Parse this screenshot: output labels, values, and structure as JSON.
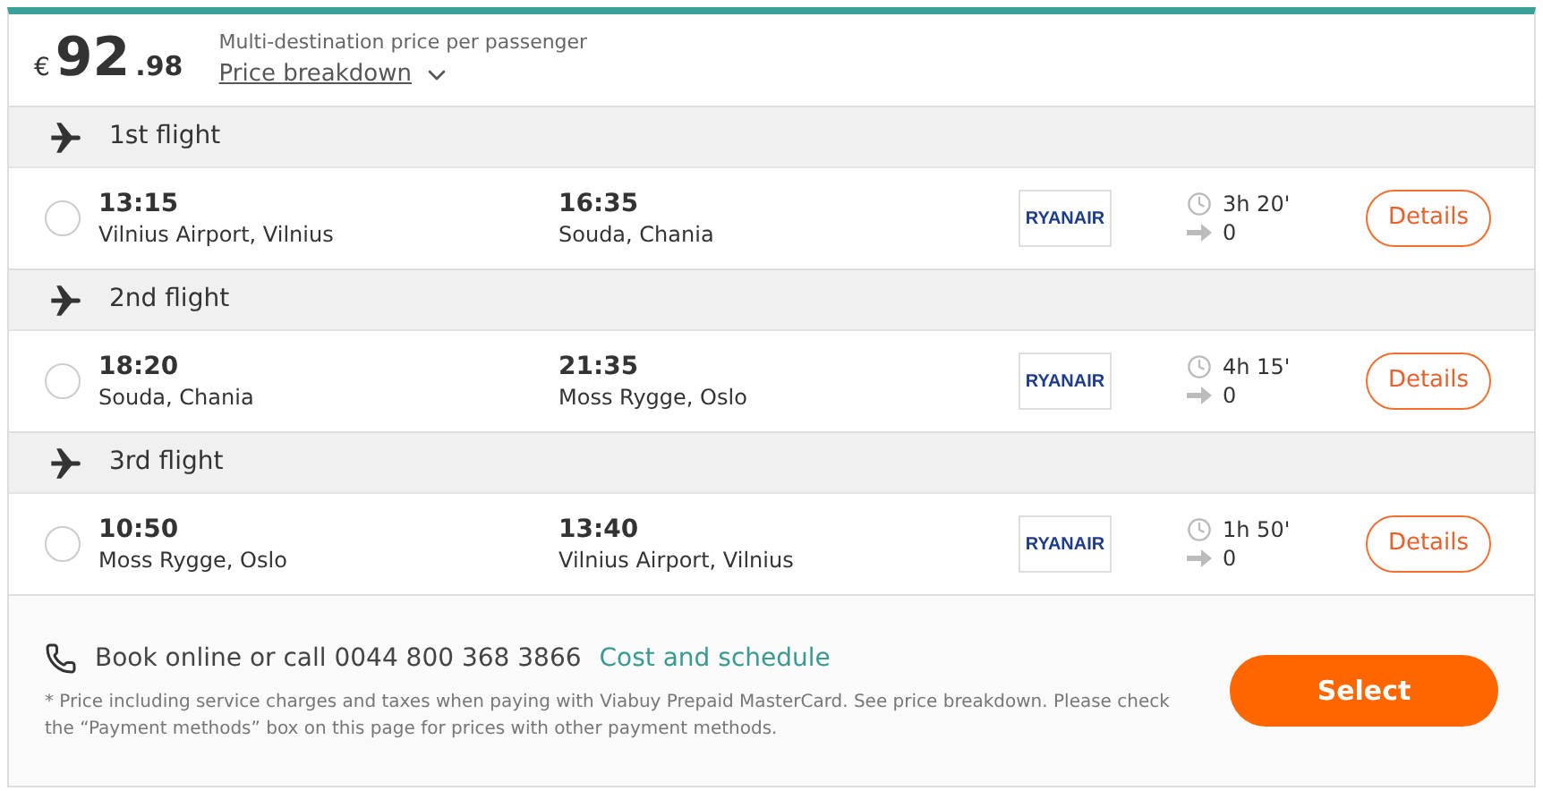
{
  "price": {
    "currency": "€",
    "whole": "92",
    "cents": ".98",
    "caption": "Multi-destination price per passenger",
    "breakdown_link": "Price breakdown"
  },
  "flights": [
    {
      "title": "1st flight",
      "selected": false,
      "depart_time": "13:15",
      "depart_place": "Vilnius Airport, Vilnius",
      "arrive_time": "16:35",
      "arrive_place": "Souda, Chania",
      "airline": "RYANAIR",
      "duration": "3h 20'",
      "stops": "0",
      "details": "Details"
    },
    {
      "title": "2nd flight",
      "selected": false,
      "depart_time": "18:20",
      "depart_place": "Souda, Chania",
      "arrive_time": "21:35",
      "arrive_place": "Moss Rygge, Oslo",
      "airline": "RYANAIR",
      "duration": "4h 15'",
      "stops": "0",
      "details": "Details"
    },
    {
      "title": "3rd flight",
      "selected": false,
      "depart_time": "10:50",
      "depart_place": "Moss Rygge, Oslo",
      "arrive_time": "13:40",
      "arrive_place": "Vilnius Airport, Vilnius",
      "airline": "RYANAIR",
      "duration": "1h 50'",
      "stops": "0",
      "details": "Details"
    }
  ],
  "footer": {
    "contact": "Book online or call 0044 800 368 3866",
    "schedule_link": "Cost and schedule",
    "note": "* Price including service charges and taxes when paying with Viabuy Prepaid MasterCard. See price breakdown. Please check the “Payment methods” box on this page for prices with other payment methods.",
    "select_button": "Select"
  }
}
